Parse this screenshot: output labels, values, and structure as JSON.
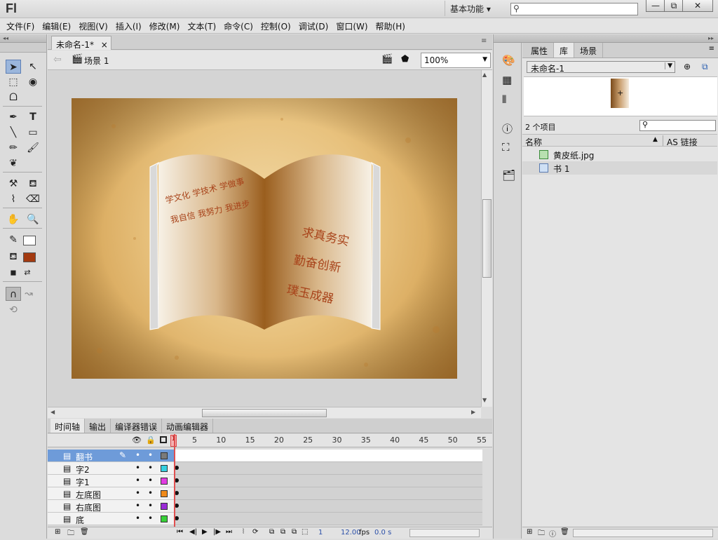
{
  "app": {
    "logo": "Fl",
    "workspace": "基本功能 ▾",
    "search_placeholder": "",
    "win_buttons": [
      "—",
      "⧉",
      "✕"
    ]
  },
  "menubar": [
    "文件(F)",
    "编辑(E)",
    "视图(V)",
    "插入(I)",
    "修改(M)",
    "文本(T)",
    "命令(C)",
    "控制(O)",
    "调试(D)",
    "窗口(W)",
    "帮助(H)"
  ],
  "document": {
    "tab": "未命名-1*",
    "tab_close": "×",
    "scene": "场景 1",
    "zoom": "100%"
  },
  "stage_text": {
    "left_line1": "学文化  学技术  学做事",
    "left_line2": "我自信  我努力  我进步",
    "right_line1": "求真务实",
    "right_line2": "勤奋创新",
    "right_line3": "璞玉成器"
  },
  "timeline": {
    "tabs": [
      "时间轴",
      "输出",
      "编译器错误",
      "动画编辑器"
    ],
    "frame_numbers": [
      "5",
      "10",
      "15",
      "20",
      "25",
      "30",
      "35",
      "40",
      "45",
      "50",
      "55"
    ],
    "current_frame": "1",
    "layers": [
      {
        "name": "翻书",
        "color": "#7a7a7a"
      },
      {
        "name": "字2",
        "color": "#35d0e0"
      },
      {
        "name": "字1",
        "color": "#e23de2"
      },
      {
        "name": "左底图",
        "color": "#f08a1a"
      },
      {
        "name": "右底图",
        "color": "#9a2bd6"
      },
      {
        "name": "底",
        "color": "#38d038"
      }
    ],
    "footer": {
      "frame": "1",
      "fps": "12.00",
      "fps_unit": "fps",
      "time": "0.0 s"
    }
  },
  "library": {
    "tabs": [
      "属性",
      "库",
      "场景"
    ],
    "document_select": "未命名-1",
    "count": "2 个项目",
    "col_name": "名称",
    "col_link": "AS 链接",
    "items": [
      {
        "name": "黄皮纸.jpg"
      },
      {
        "name": "书 1"
      }
    ]
  }
}
